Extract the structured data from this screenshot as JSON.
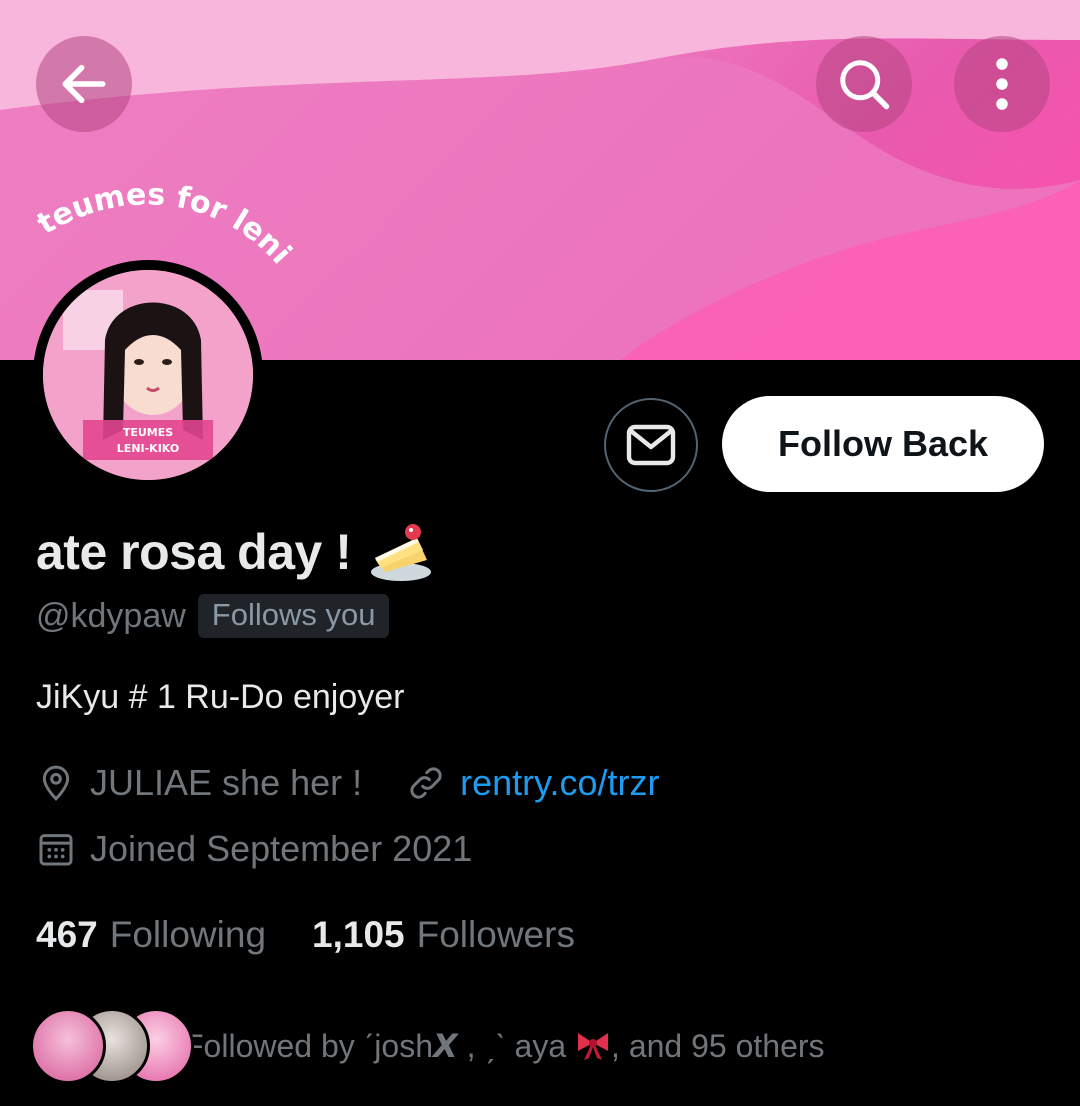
{
  "banner": {
    "arc_text": "teumes for leni",
    "back_icon": "arrow-left-icon",
    "search_icon": "search-icon",
    "more_icon": "more-vertical-icon"
  },
  "avatar": {
    "text_line1": "TEUMES",
    "text_line2": "LENI-KIKO"
  },
  "actions": {
    "message_icon": "mail-icon",
    "follow_label": "Follow Back"
  },
  "profile": {
    "display_name": "ate rosa day !",
    "name_emoji": "cake-icon",
    "handle": "@kdypaw",
    "follows_you": "Follows you",
    "bio": "JiKyu # 1 Ru-Do enjoyer",
    "location": "JULIAE she her !",
    "location_icon": "location-pin-icon",
    "link": "rentry.co/trzr",
    "link_icon": "link-icon",
    "joined": "Joined September 2021",
    "joined_icon": "calendar-icon"
  },
  "stats": {
    "following_count": "467",
    "following_label": "Following",
    "followers_count": "1,105",
    "followers_label": "Followers"
  },
  "followed_by": {
    "text_prefix": "Followed by ˊjosh",
    "x_mark": "𝙓",
    "text_middle": " , ˏˋ aya ",
    "text_suffix": ", and 95 others",
    "bow_icon": "ribbon-bow-icon"
  },
  "colors": {
    "background": "#000000",
    "primary_text": "#e7e9ea",
    "secondary_text": "#71767b",
    "link": "#1d9bf0",
    "banner_pink": "#ef7fc2"
  }
}
